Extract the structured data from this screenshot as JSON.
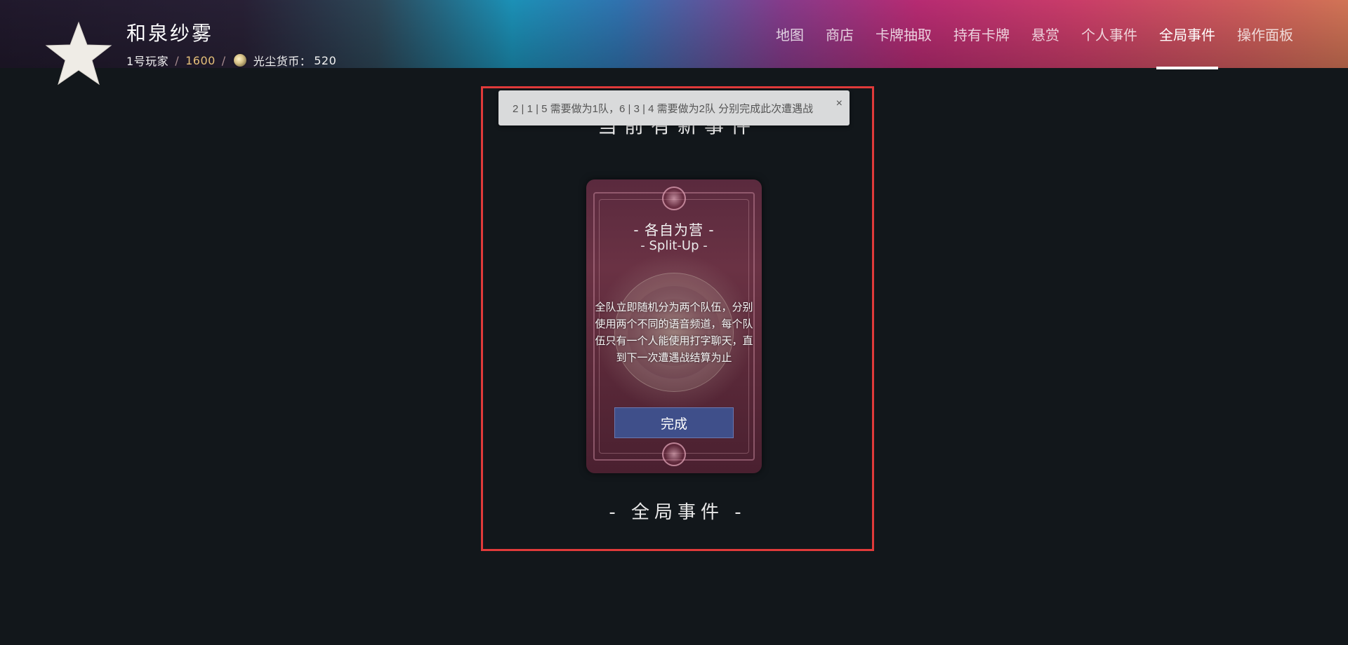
{
  "header": {
    "user_name": "和泉纱雾",
    "player_label": "1号玩家",
    "separator": "/",
    "score": "1600",
    "currency_label": "光尘货币：",
    "currency_value": "520",
    "nav": [
      {
        "label": "地图",
        "active": false
      },
      {
        "label": "商店",
        "active": false
      },
      {
        "label": "卡牌抽取",
        "active": false
      },
      {
        "label": "持有卡牌",
        "active": false
      },
      {
        "label": "悬赏",
        "active": false
      },
      {
        "label": "个人事件",
        "active": false
      },
      {
        "label": "全局事件",
        "active": true
      },
      {
        "label": "操作面板",
        "active": false
      }
    ]
  },
  "toast": {
    "message": "2 | 1 | 5 需要做为1队，6 | 3 | 4 需要做为2队 分别完成此次遭遇战",
    "close_label": "×"
  },
  "event": {
    "heading": "当前有新事件",
    "footer": "- 全局事件 -",
    "card": {
      "title": "- 各自为营 -",
      "subtitle": "- Split-Up -",
      "description": "全队立即随机分为两个队伍，分别使用两个不同的语音频道，每个队伍只有一个人能使用打字聊天，直到下一次遭遇战结算为止",
      "button_label": "完成"
    }
  }
}
